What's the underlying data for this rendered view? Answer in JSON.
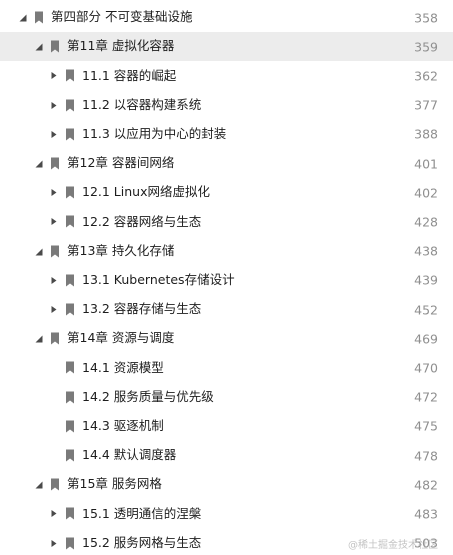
{
  "entries": [
    {
      "label": "第四部分 不可变基础设施",
      "page": "358",
      "level": 0,
      "toggle": "down"
    },
    {
      "label": "第11章 虚拟化容器",
      "page": "359",
      "level": 1,
      "toggle": "down",
      "highlight": true
    },
    {
      "label": "11.1 容器的崛起",
      "page": "362",
      "level": 2,
      "toggle": "right"
    },
    {
      "label": "11.2 以容器构建系统",
      "page": "377",
      "level": 2,
      "toggle": "right"
    },
    {
      "label": "11.3 以应用为中心的封装",
      "page": "388",
      "level": 2,
      "toggle": "right"
    },
    {
      "label": "第12章 容器间网络",
      "page": "401",
      "level": 1,
      "toggle": "down"
    },
    {
      "label": "12.1 Linux网络虚拟化",
      "page": "402",
      "level": 2,
      "toggle": "right"
    },
    {
      "label": "12.2 容器网络与生态",
      "page": "428",
      "level": 2,
      "toggle": "right"
    },
    {
      "label": "第13章 持久化存储",
      "page": "438",
      "level": 1,
      "toggle": "down"
    },
    {
      "label": "13.1 Kubernetes存储设计",
      "page": "439",
      "level": 2,
      "toggle": "right"
    },
    {
      "label": "13.2 容器存储与生态",
      "page": "452",
      "level": 2,
      "toggle": "right"
    },
    {
      "label": "第14章 资源与调度",
      "page": "469",
      "level": 1,
      "toggle": "down"
    },
    {
      "label": "14.1 资源模型",
      "page": "470",
      "level": 2,
      "toggle": "none"
    },
    {
      "label": "14.2 服务质量与优先级",
      "page": "472",
      "level": 2,
      "toggle": "none"
    },
    {
      "label": "14.3 驱逐机制",
      "page": "475",
      "level": 2,
      "toggle": "none"
    },
    {
      "label": "14.4 默认调度器",
      "page": "478",
      "level": 2,
      "toggle": "none"
    },
    {
      "label": "第15章 服务网格",
      "page": "482",
      "level": 1,
      "toggle": "down"
    },
    {
      "label": "15.1 透明通信的涅槃",
      "page": "483",
      "level": 2,
      "toggle": "right"
    }
  ],
  "partial_entry": {
    "label": "15.2 服务网格与生态",
    "page": "503",
    "level": 2,
    "toggle": "right"
  },
  "watermark": "@稀土掘金技术社区",
  "colors": {
    "highlight": "#ececec",
    "page_number": "#8f8f8f",
    "bookmark_fill": "#7a7a7a",
    "toggle_fill": "#4a4a4a"
  }
}
